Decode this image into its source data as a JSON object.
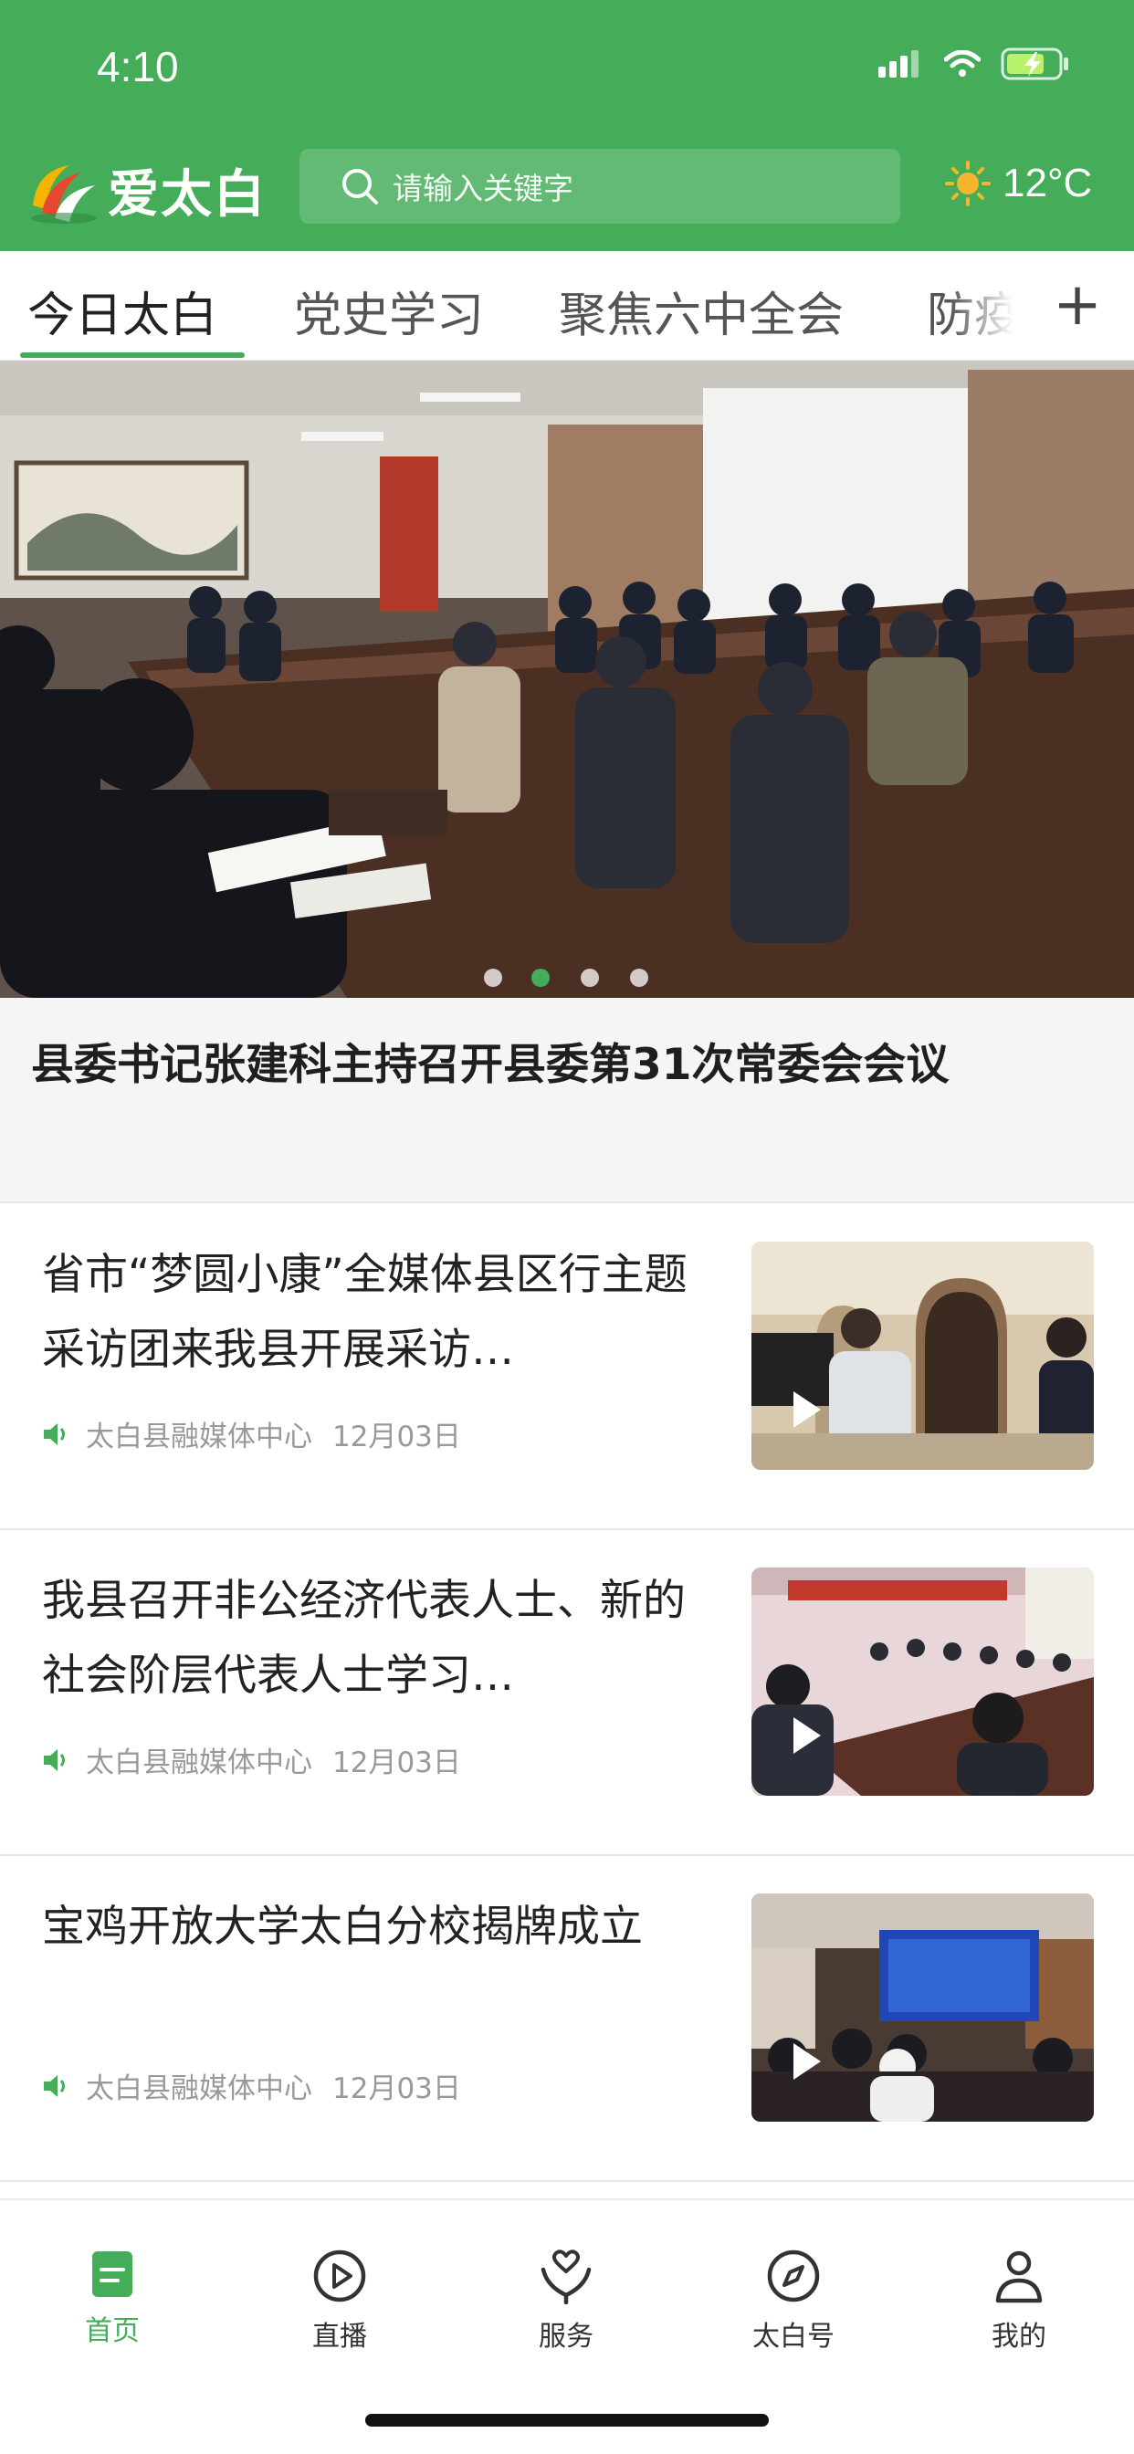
{
  "status_bar": {
    "time": "4:10",
    "icons": [
      "signal-icon",
      "wifi-icon",
      "battery-charging-icon"
    ]
  },
  "header": {
    "logo_text": "爱太白",
    "search_placeholder": "请输入关键字",
    "weather_icon": "sun-icon",
    "temperature": "12°C"
  },
  "tabs": {
    "items": [
      "今日太白",
      "党史学习",
      "聚焦六中全会",
      "防疫"
    ],
    "active_index": 0,
    "add_label": "+"
  },
  "hero": {
    "title": "县委书记张建科主持召开县委第31次常委会会议",
    "slides_count": 4,
    "active_slide": 1
  },
  "news": [
    {
      "title": "省市“梦圆小康”全媒体县区行主题采访团来我县开展采访…",
      "source": "太白县融媒体中心",
      "date": "12月03日",
      "has_video": true
    },
    {
      "title": "我县召开非公经济代表人士、新的社会阶层代表人士学习…",
      "source": "太白县融媒体中心",
      "date": "12月03日",
      "has_video": true
    },
    {
      "title": "宝鸡开放大学太白分校揭牌成立",
      "source": "太白县融媒体中心",
      "date": "12月03日",
      "has_video": true
    }
  ],
  "bottom_nav": {
    "items": [
      {
        "label": "首页",
        "icon": "home-icon"
      },
      {
        "label": "直播",
        "icon": "play-circle-icon"
      },
      {
        "label": "服务",
        "icon": "heart-hands-icon"
      },
      {
        "label": "太白号",
        "icon": "compass-icon"
      },
      {
        "label": "我的",
        "icon": "person-icon"
      }
    ],
    "active_index": 0
  },
  "colors": {
    "brand_green": "#45ad5a",
    "text_dark": "#222222",
    "meta_gray": "#999999"
  }
}
